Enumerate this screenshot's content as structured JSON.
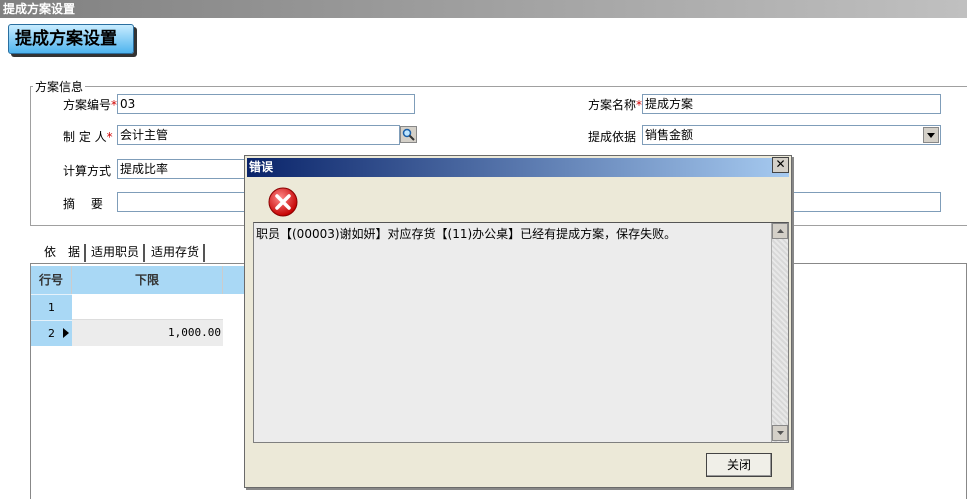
{
  "window": {
    "title": "提成方案设置"
  },
  "page": {
    "title": "提成方案设置"
  },
  "form": {
    "group_label": "方案信息",
    "scheme_no": {
      "label": "方案编号",
      "required_mark": "*",
      "value": "03"
    },
    "scheme_name": {
      "label": "方案名称",
      "required_mark": "*",
      "value": "提成方案"
    },
    "creator": {
      "label": "制 定 人",
      "required_mark": "*",
      "value": "会计主管"
    },
    "basis": {
      "label": "提成依据",
      "value": "销售金额"
    },
    "calc_method": {
      "label": "计算方式",
      "value": "提成比率"
    },
    "summary": {
      "label": "摘　 要",
      "value": ""
    }
  },
  "tabs": [
    "依　据",
    "适用职员",
    "适用存货"
  ],
  "grid": {
    "headers": {
      "row_no": "行号",
      "lower_limit": "下限"
    },
    "rows": [
      {
        "row_no": "1",
        "lower_limit": ""
      },
      {
        "row_no": "2",
        "lower_limit": "1,000.00"
      }
    ]
  },
  "dialog": {
    "title": "错误",
    "message": "职员【(00003)谢如妍】对应存货【(11)办公桌】已经有提成方案，保存失败。",
    "close_button": "关闭",
    "close_glyph": "✕",
    "icon": "error-icon"
  }
}
